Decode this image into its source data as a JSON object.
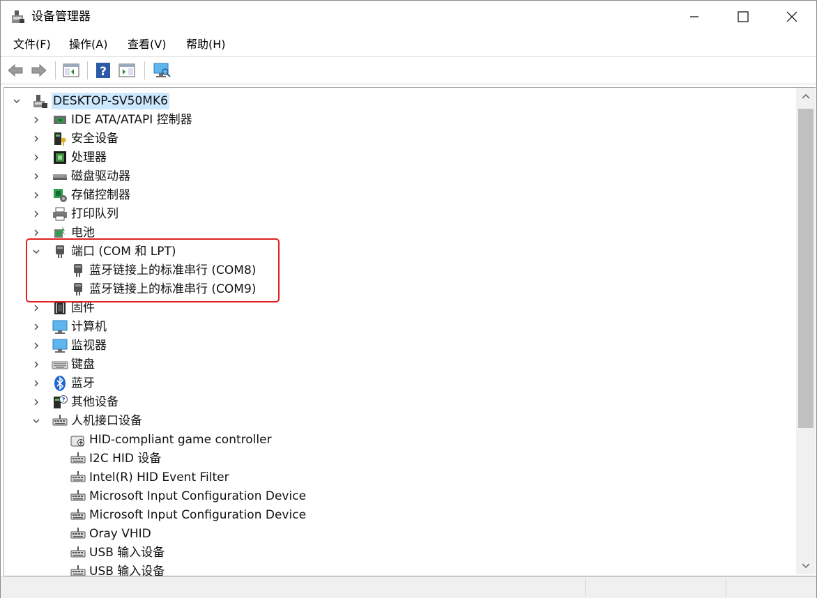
{
  "window": {
    "title": "设备管理器",
    "title_icon": "device-manager-icon"
  },
  "menubar": {
    "items": [
      {
        "label": "文件(F)"
      },
      {
        "label": "操作(A)"
      },
      {
        "label": "查看(V)"
      },
      {
        "label": "帮助(H)"
      }
    ]
  },
  "toolbar": {
    "buttons": [
      "back-arrow-icon",
      "forward-arrow-icon",
      "show-hide-console-tree-icon",
      "help-icon",
      "action-pane-icon",
      "monitor-icon"
    ]
  },
  "tree": {
    "root": {
      "label": "DESKTOP-SV50MK6",
      "icon": "computer-icon",
      "expanded": true
    },
    "categories": [
      {
        "label": "IDE ATA/ATAPI 控制器",
        "icon": "ide-controller-icon",
        "expanded": false
      },
      {
        "label": "安全设备",
        "icon": "security-device-icon",
        "expanded": false
      },
      {
        "label": "处理器",
        "icon": "processor-icon",
        "expanded": false
      },
      {
        "label": "磁盘驱动器",
        "icon": "disk-drive-icon",
        "expanded": false
      },
      {
        "label": "存储控制器",
        "icon": "storage-controller-icon",
        "expanded": false
      },
      {
        "label": "打印队列",
        "icon": "printer-icon",
        "expanded": false
      },
      {
        "label": "电池",
        "icon": "battery-icon",
        "expanded": false
      },
      {
        "label": "端口 (COM 和 LPT)",
        "icon": "port-icon",
        "expanded": true,
        "children": [
          {
            "label": "蓝牙链接上的标准串行 (COM8)",
            "icon": "port-icon"
          },
          {
            "label": "蓝牙链接上的标准串行 (COM9)",
            "icon": "port-icon"
          }
        ]
      },
      {
        "label": "固件",
        "icon": "firmware-icon",
        "expanded": false
      },
      {
        "label": "计算机",
        "icon": "monitor-icon",
        "expanded": false
      },
      {
        "label": "监视器",
        "icon": "monitor-icon",
        "expanded": false
      },
      {
        "label": "键盘",
        "icon": "keyboard-icon",
        "expanded": false
      },
      {
        "label": "蓝牙",
        "icon": "bluetooth-icon",
        "expanded": false
      },
      {
        "label": "其他设备",
        "icon": "unknown-device-icon",
        "expanded": false
      },
      {
        "label": "人机接口设备",
        "icon": "hid-icon",
        "expanded": true,
        "children": [
          {
            "label": "HID-compliant game controller",
            "icon": "game-controller-icon"
          },
          {
            "label": "I2C HID 设备",
            "icon": "hid-icon"
          },
          {
            "label": "Intel(R) HID Event Filter",
            "icon": "hid-icon"
          },
          {
            "label": "Microsoft Input Configuration Device",
            "icon": "hid-icon"
          },
          {
            "label": "Microsoft Input Configuration Device",
            "icon": "hid-icon"
          },
          {
            "label": "Oray VHID",
            "icon": "hid-icon"
          },
          {
            "label": "USB 输入设备",
            "icon": "hid-icon"
          },
          {
            "label": "USB 输入设备",
            "icon": "hid-icon"
          }
        ]
      }
    ]
  },
  "colors": {
    "selection": "#cce8ff",
    "highlight_box": "#e02020"
  }
}
